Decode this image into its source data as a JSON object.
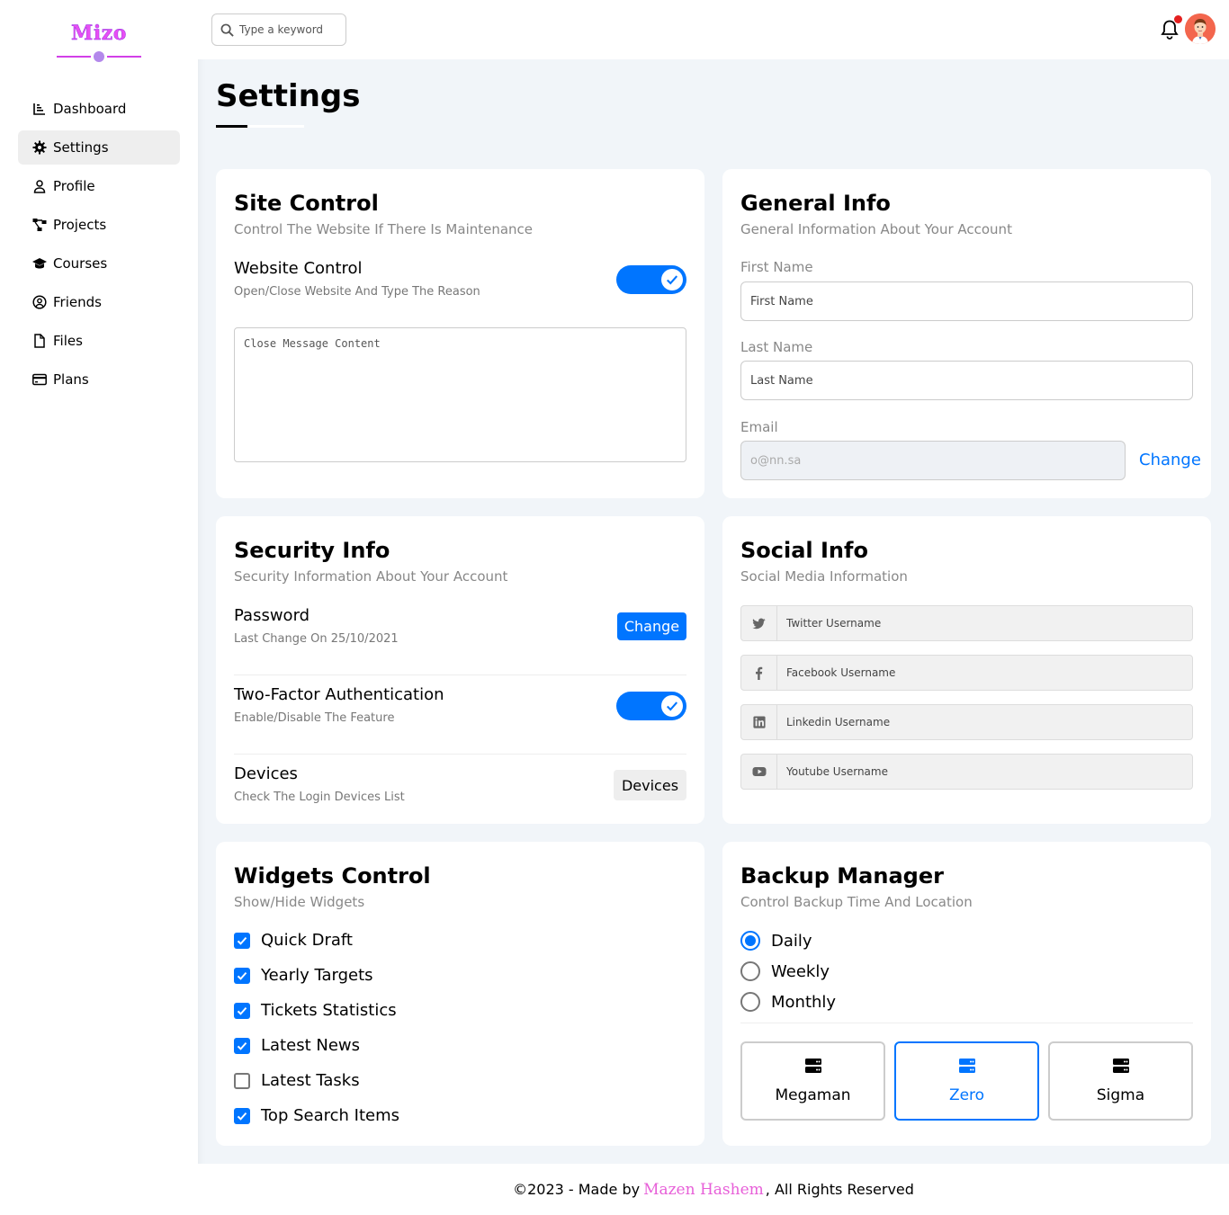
{
  "brand": {
    "logo_text": "Mizo"
  },
  "sidebar": {
    "items": [
      {
        "label": "Dashboard",
        "icon": "chart-icon"
      },
      {
        "label": "Settings",
        "icon": "gear-icon"
      },
      {
        "label": "Profile",
        "icon": "user-icon"
      },
      {
        "label": "Projects",
        "icon": "diagram-icon"
      },
      {
        "label": "Courses",
        "icon": "graduation-cap-icon"
      },
      {
        "label": "Friends",
        "icon": "user-circle-icon"
      },
      {
        "label": "Files",
        "icon": "file-icon"
      },
      {
        "label": "Plans",
        "icon": "credit-card-icon"
      }
    ],
    "active_item": "Settings"
  },
  "header": {
    "search_placeholder": "Type a keyword",
    "has_notification": true
  },
  "page": {
    "title": "Settings"
  },
  "site_control": {
    "title": "Site Control",
    "subtitle": "Control The Website If There Is Maintenance",
    "website_control_label": "Website Control",
    "website_control_sub": "Open/Close Website And Type The Reason",
    "website_control_on": true,
    "message_placeholder": "Close Message Content"
  },
  "general_info": {
    "title": "General Info",
    "subtitle": "General Information About Your Account",
    "first_name_label": "First Name",
    "first_name_placeholder": "First Name",
    "last_name_label": "Last Name",
    "last_name_placeholder": "Last Name",
    "email_label": "Email",
    "email_placeholder": "o@nn.sa",
    "change_label": "Change"
  },
  "security_info": {
    "title": "Security Info",
    "subtitle": "Security Information About Your Account",
    "password_label": "Password",
    "password_sub": "Last Change On 25/10/2021",
    "password_button": "Change",
    "two_factor_label": "Two-Factor Authentication",
    "two_factor_sub": "Enable/Disable The Feature",
    "two_factor_on": true,
    "devices_label": "Devices",
    "devices_sub": "Check The Login Devices List",
    "devices_button": "Devices"
  },
  "social_info": {
    "title": "Social Info",
    "subtitle": "Social Media Information",
    "fields": [
      {
        "icon": "twitter-icon",
        "placeholder": "Twitter Username"
      },
      {
        "icon": "facebook-icon",
        "placeholder": "Facebook Username"
      },
      {
        "icon": "linkedin-icon",
        "placeholder": "Linkedin Username"
      },
      {
        "icon": "youtube-icon",
        "placeholder": "Youtube Username"
      }
    ]
  },
  "widgets_control": {
    "title": "Widgets Control",
    "subtitle": "Show/Hide Widgets",
    "items": [
      {
        "label": "Quick Draft",
        "checked": true
      },
      {
        "label": "Yearly Targets",
        "checked": true
      },
      {
        "label": "Tickets Statistics",
        "checked": true
      },
      {
        "label": "Latest News",
        "checked": true
      },
      {
        "label": "Latest Tasks",
        "checked": false
      },
      {
        "label": "Top Search Items",
        "checked": true
      }
    ]
  },
  "backup_manager": {
    "title": "Backup Manager",
    "subtitle": "Control Backup Time And Location",
    "frequencies": [
      {
        "label": "Daily",
        "selected": true
      },
      {
        "label": "Weekly",
        "selected": false
      },
      {
        "label": "Monthly",
        "selected": false
      }
    ],
    "servers": [
      {
        "label": "Megaman",
        "selected": false
      },
      {
        "label": "Zero",
        "selected": true
      },
      {
        "label": "Sigma",
        "selected": false
      }
    ]
  },
  "footer": {
    "prefix": "©2023 - Made by",
    "author": "Mazen Hashem",
    "suffix": ", All Rights Reserved"
  },
  "colors": {
    "accent": "#0075ff",
    "brand": "#e84ff3",
    "notification": "#e41f1f"
  }
}
